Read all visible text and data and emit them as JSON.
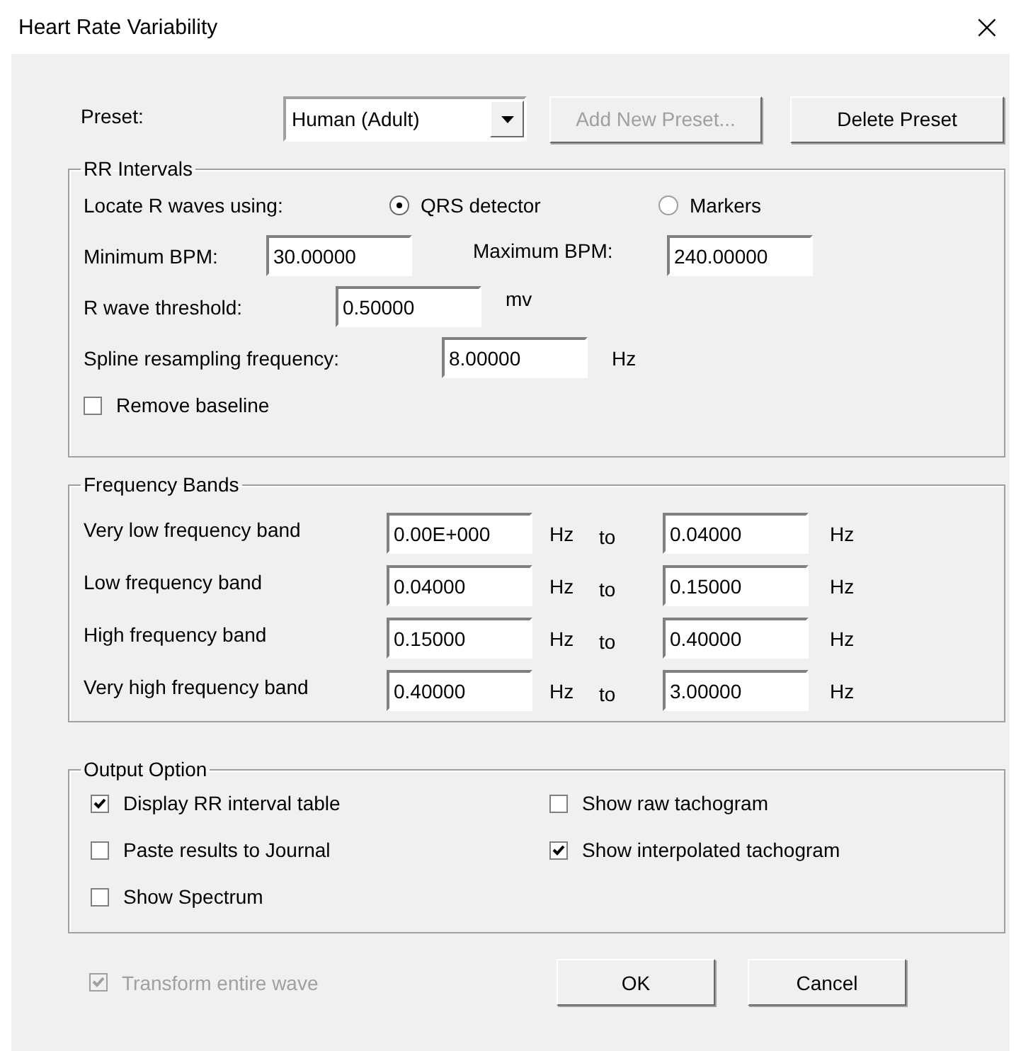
{
  "window": {
    "title": "Heart Rate Variability",
    "close": "×"
  },
  "preset": {
    "label": "Preset:",
    "value": "Human (Adult)",
    "buttons": [
      {
        "label": "Add New Preset...",
        "disabled": true
      },
      {
        "label": "Delete Preset",
        "disabled": false
      }
    ]
  },
  "rr_intervals": {
    "title": "RR Intervals",
    "locate_label": "Locate R waves using:",
    "options": [
      {
        "label": "QRS detector",
        "selected": true
      },
      {
        "label": "Markers",
        "selected": false
      }
    ],
    "min_bpm": {
      "label": "Minimum BPM:",
      "value": "30.00000"
    },
    "max_bpm": {
      "label": "Maximum BPM:",
      "value": "240.00000"
    },
    "threshold": {
      "label": "R wave threshold:",
      "value": "0.50000",
      "unit": "mv"
    },
    "spline": {
      "label": "Spline resampling frequency:",
      "value": "8.00000",
      "unit": "Hz"
    },
    "remove_baseline": {
      "label": "Remove baseline",
      "checked": false
    }
  },
  "frequency_bands": {
    "title": "Frequency Bands",
    "rows": [
      {
        "label": "Very low frequency band",
        "from": "0.00E+000",
        "unit_from": "Hz",
        "to": "to",
        "upper": "0.04000",
        "unit_to": "Hz"
      },
      {
        "label": "Low frequency band",
        "from": "0.04000",
        "unit_from": "Hz",
        "to": "to",
        "upper": "0.15000",
        "unit_to": "Hz"
      },
      {
        "label": "High frequency band",
        "from": "0.15000",
        "unit_from": "Hz",
        "to": "to",
        "upper": "0.40000",
        "unit_to": "Hz"
      },
      {
        "label": "Very high frequency band",
        "from": "0.40000",
        "unit_from": "Hz",
        "to": "to",
        "upper": "3.00000",
        "unit_to": "Hz"
      }
    ]
  },
  "output_option": {
    "title": "Output Option",
    "options": [
      {
        "label": "Display RR interval table",
        "checked": true
      },
      {
        "label": "Show raw tachogram",
        "checked": false
      },
      {
        "label": "Paste results to Journal",
        "checked": false
      },
      {
        "label": "Show interpolated tachogram",
        "checked": true
      },
      {
        "label": "Show Spectrum",
        "checked": false
      }
    ]
  },
  "transform": {
    "label": "Transform entire wave",
    "checked": true,
    "disabled": true
  },
  "buttons": [
    "OK",
    "Cancel"
  ]
}
